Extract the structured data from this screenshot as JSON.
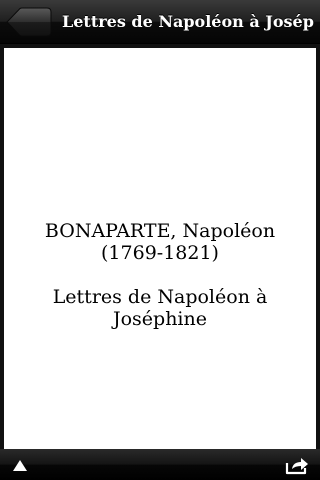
{
  "navbar": {
    "title": "Lettres de Napoléon à Joséph...",
    "back_icon": "back-arrow-icon"
  },
  "page": {
    "author": "BONAPARTE, Napoléon",
    "dates": "(1769-1821)",
    "book_title_line1": "Lettres de Napoléon à",
    "book_title_line2": "Joséphine"
  },
  "toolbar": {
    "left_icon": "triangle-up-icon",
    "right_icon": "share-icon"
  },
  "colors": {
    "bar_background": "#1a1a1a",
    "page_background": "#ffffff",
    "text": "#000000",
    "nav_text": "#ffffff"
  }
}
